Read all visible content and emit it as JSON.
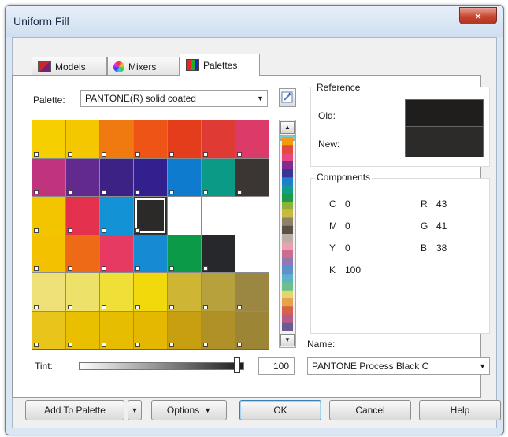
{
  "window": {
    "title": "Uniform Fill",
    "close_label": "×"
  },
  "tabs": [
    {
      "label": "Models",
      "icon": "models-icon"
    },
    {
      "label": "Mixers",
      "icon": "mixers-icon"
    },
    {
      "label": "Palettes",
      "icon": "palettes-icon"
    }
  ],
  "palette": {
    "label": "Palette:",
    "value": "PANTONE(R) solid coated"
  },
  "swatches": [
    [
      "#f5cf00",
      "#f4c700",
      "#f07a10",
      "#ee5416",
      "#e43d1c",
      "#e03a35",
      "#dc3b6a"
    ],
    [
      "#c0337d",
      "#622a8c",
      "#3b2284",
      "#33208e",
      "#0f7bcf",
      "#0b9a86",
      "#3b3634"
    ],
    [
      "#f3c400",
      "#e4324e",
      "#1392d6",
      "#2b2a28",
      "",
      "",
      ""
    ],
    [
      "#f3c100",
      "#ef6a16",
      "#e63a62",
      "#168ad2",
      "#0a9a48",
      "#26282c",
      ""
    ],
    [
      "#efe078",
      "#eee16a",
      "#f0df36",
      "#f2d90c",
      "#cfb534",
      "#b7a13d",
      "#9b8742"
    ],
    [
      "#e9c41a",
      "#e8c000",
      "#e6bd00",
      "#e4b800",
      "#c79f11",
      "#b09127",
      "#9c8534"
    ]
  ],
  "reference": {
    "title": "Reference",
    "old_label": "Old:",
    "new_label": "New:",
    "old_color": "#201e1c",
    "new_color": "#2d2b29"
  },
  "components": {
    "title": "Components",
    "cmyk": [
      {
        "k": "C",
        "v": "0"
      },
      {
        "k": "M",
        "v": "0"
      },
      {
        "k": "Y",
        "v": "0"
      },
      {
        "k": "K",
        "v": "100"
      }
    ],
    "rgb": [
      {
        "k": "R",
        "v": "43"
      },
      {
        "k": "G",
        "v": "41"
      },
      {
        "k": "B",
        "v": "38"
      }
    ]
  },
  "name": {
    "label": "Name:",
    "value": "PANTONE Process Black C"
  },
  "tint": {
    "label": "Tint:",
    "value": "100",
    "level": 1.0
  },
  "buttons": {
    "add": "Add To Palette",
    "options": "Options",
    "ok": "OK",
    "cancel": "Cancel",
    "help": "Help"
  }
}
